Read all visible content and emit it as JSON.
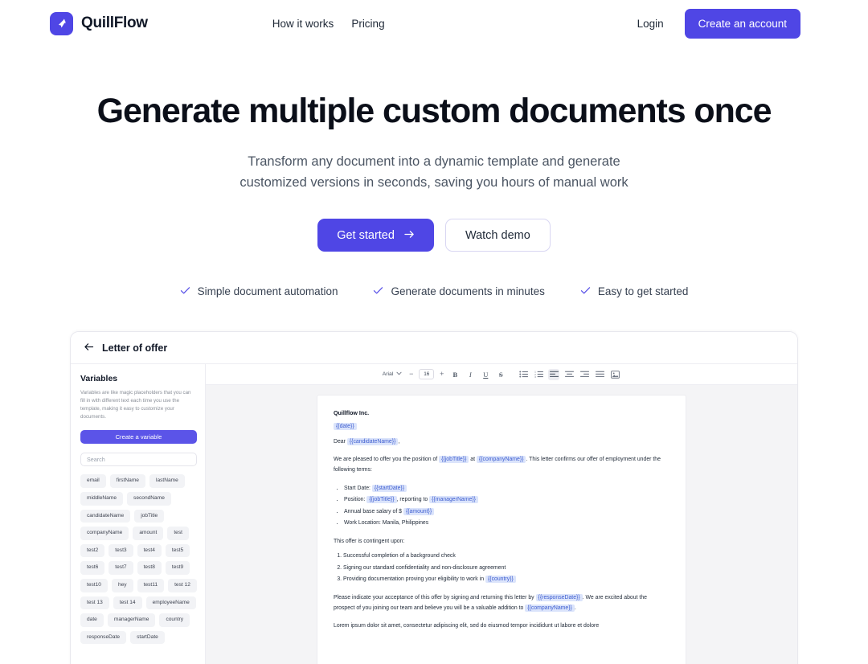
{
  "nav": {
    "brand": "QuillFlow",
    "brand_icon": "cursor-arrow-icon",
    "links": [
      {
        "label": "How it works"
      },
      {
        "label": "Pricing"
      }
    ],
    "login_label": "Login",
    "create_account_label": "Create an account"
  },
  "hero": {
    "title": "Generate multiple custom documents once",
    "subtitle": "Transform any document into a dynamic template and generate customized versions in seconds, saving you hours of manual work",
    "primary_cta": "Get started",
    "primary_cta_icon": "arrow-right-icon",
    "secondary_cta": "Watch demo",
    "features": [
      "Simple document automation",
      "Generate documents in minutes",
      "Easy to get started"
    ]
  },
  "app": {
    "back_icon": "arrow-left-icon",
    "document_title": "Letter of offer",
    "variables": {
      "heading": "Variables",
      "description": "Variables are like magic placeholders that you can fill in with different text each time you use the template, making it easy to customize your documents.",
      "create_button": "Create a variable",
      "search_placeholder": "Search",
      "search_value": "",
      "chips": [
        "email",
        "firstName",
        "lastName",
        "middleName",
        "secondName",
        "candidateName",
        "jobTitle",
        "companyName",
        "amount",
        "test",
        "test2",
        "test3",
        "test4",
        "test5",
        "test6",
        "test7",
        "test8",
        "test9",
        "test10",
        "hey",
        "test11",
        "test 12",
        "test 13",
        "test 14",
        "employeeName",
        "date",
        "managerName",
        "country",
        "responseDate",
        "startDate"
      ]
    },
    "toolbar": {
      "font_family": "Arial",
      "font_dropdown_icon": "chevron-down-icon",
      "decrease_icon": "minus-icon",
      "font_size": "16",
      "increase_icon": "plus-icon",
      "bold": "B",
      "italic": "I",
      "underline": "U",
      "strikethrough": "S",
      "bullet_list_icon": "bullet-list-icon",
      "numbered_list_icon": "numbered-list-icon",
      "align_left_icon": "align-left-icon",
      "align_center_icon": "align-center-icon",
      "align_right_icon": "align-right-icon",
      "align_justify_icon": "align-justify-icon",
      "image_icon": "image-icon"
    },
    "document": {
      "company": "Quillflow Inc.",
      "date_var": "{{date}}",
      "salutation": "Dear",
      "candidate_var": "{{candidateName}}",
      "salutation_comma": ",",
      "offer_line_1": "We are pleased to offer you the position of",
      "job_title_var": "{{jobTitle}}",
      "offer_line_2": "at",
      "company_var": "{{companyName}}",
      "offer_line_3": ". This letter confirms our offer of employment under the following terms:",
      "terms": {
        "start_date_label": "Start Date:",
        "start_date_var": "{{startDate}}",
        "position_label": "Position:",
        "position_var": "{{jobTitle}}",
        "position_reporting": ", reporting to",
        "manager_var": "{{managerName}}",
        "salary_label": "Annual base salary of $",
        "salary_var": "{{amount}}",
        "work_location": "Work Location: Manila, Philippines"
      },
      "contingent_heading": "This offer is contingent upon:",
      "contingent_1": "Successful completion of a background check",
      "contingent_2": "Signing our standard confidentiality and non-disclosure agreement",
      "contingent_3": "Providing documentation proving your eligibility to work in",
      "country_var": "{{country}}",
      "closing_line_1": "Please indicate your acceptance of this offer by signing and returning this letter by",
      "response_date_var": "{{responseDate}}",
      "closing_period": ".",
      "closing_line_2": "We are excited about the prospect of you joining our team and believe you will be a valuable addition to",
      "closing_company_var": "{{companyName}}",
      "closing_line_3": ".",
      "lorem": "Lorem ipsum dolor sit amet, consectetur adipiscing elit, sed do eiusmod tempor incididunt ut labore et dolore"
    }
  },
  "colors": {
    "brand": "#4f46e5",
    "variable_bg": "#dbe4fb",
    "variable_text": "#3c5ccf"
  }
}
